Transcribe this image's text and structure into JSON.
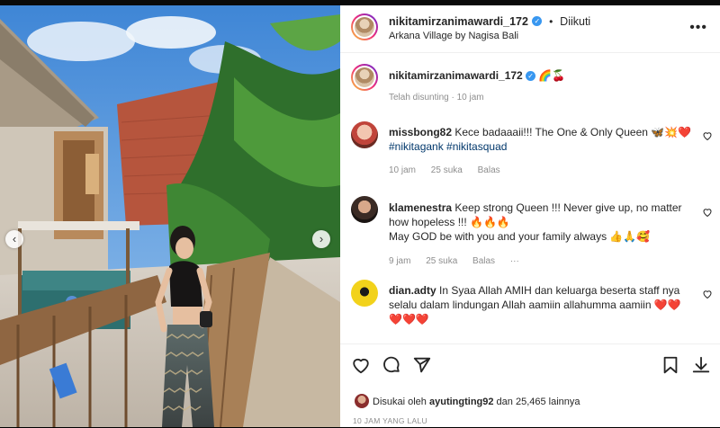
{
  "post": {
    "author": "nikitamirzanimawardi_172",
    "follow_status": "Diikuti",
    "location": "Arkana Village by Nagisa Bali",
    "caption_emoji": "🌈🍒",
    "edited_label": "Telah disunting · 10 jam",
    "likes_text_prefix": "Disukai oleh ",
    "likes_user": "ayutingting92",
    "likes_text_suffix": " dan 25,465 lainnya",
    "time_ago": "10 JAM YANG LALU"
  },
  "comments": [
    {
      "user": "missbong82",
      "text": "Kece badaaaii!!! The One & Only Queen 🦋💥❤️",
      "hashtags": "#nikitagank #nikitasquad",
      "time": "10 jam",
      "likes": "25 suka",
      "reply": "Balas"
    },
    {
      "user": "klamenestra",
      "text_line1": "Keep strong Queen !!! Never give up, no matter",
      "text_line2": "how hopeless !!! 🔥🔥🔥",
      "text_line3": "May GOD be with you and your family always 👍🙏🥰",
      "time": "9 jam",
      "likes": "25 suka",
      "reply": "Balas",
      "more": "···"
    },
    {
      "user": "dian.adty",
      "text_line1": "In Syaa Allah AMIH dan keluarga beserta staff nya",
      "text_line2": "selalu dalam lindungan Allah aamiin allahumma aamiin ❤️❤️",
      "text_line3": "❤️❤️❤️"
    }
  ],
  "icons": {
    "like": "heart-icon",
    "comment": "comment-icon",
    "share": "send-icon",
    "save": "bookmark-icon",
    "download": "download-icon"
  },
  "colors": {
    "verified": "#3897f0",
    "hashtag": "#00376b",
    "meta": "#8e8e8e"
  }
}
